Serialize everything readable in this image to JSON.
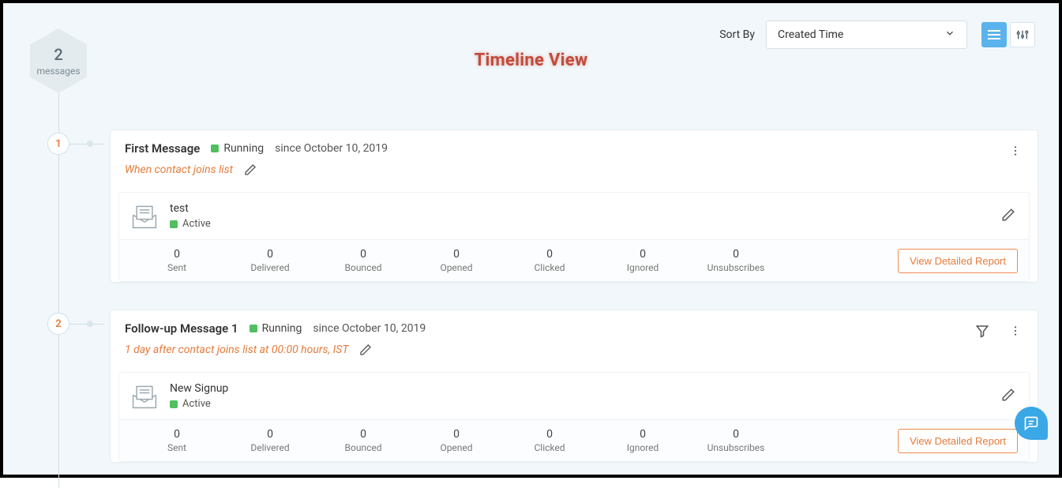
{
  "page_title": "Timeline View",
  "sort": {
    "label": "Sort By",
    "value": "Created Time"
  },
  "counter": {
    "count": "2",
    "label": "messages"
  },
  "report_button_label": "View Detailed Report",
  "stat_labels": [
    "Sent",
    "Delivered",
    "Bounced",
    "Opened",
    "Clicked",
    "Ignored",
    "Unsubscribes"
  ],
  "messages": [
    {
      "index": "1",
      "title": "First Message",
      "status": "Running",
      "since": "since October 10, 2019",
      "trigger": "When contact joins list",
      "has_filter": false,
      "content": {
        "name": "test",
        "status": "Active"
      },
      "stats": [
        "0",
        "0",
        "0",
        "0",
        "0",
        "0",
        "0"
      ]
    },
    {
      "index": "2",
      "title": "Follow-up Message 1",
      "status": "Running",
      "since": "since October 10, 2019",
      "trigger": "1  day after contact joins list at  00:00 hours, IST",
      "has_filter": true,
      "content": {
        "name": "New Signup",
        "status": "Active"
      },
      "stats": [
        "0",
        "0",
        "0",
        "0",
        "0",
        "0",
        "0"
      ]
    }
  ]
}
